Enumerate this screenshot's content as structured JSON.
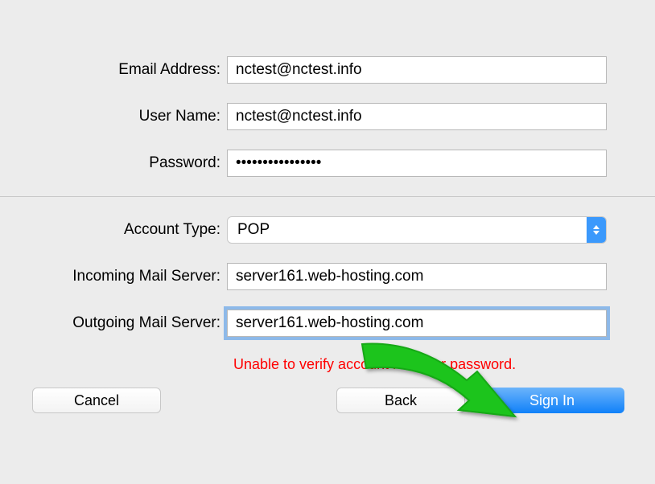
{
  "labels": {
    "email": "Email Address:",
    "username": "User Name:",
    "password": "Password:",
    "accountType": "Account Type:",
    "incoming": "Incoming Mail Server:",
    "outgoing": "Outgoing Mail Server:"
  },
  "values": {
    "email": "nctest@nctest.info",
    "username": "nctest@nctest.info",
    "password": "••••••••••••••••",
    "accountType": "POP",
    "incoming": "server161.web-hosting.com",
    "outgoing": "server161.web-hosting.com"
  },
  "error": "Unable to verify account name or password.",
  "buttons": {
    "cancel": "Cancel",
    "back": "Back",
    "signin": "Sign In"
  }
}
